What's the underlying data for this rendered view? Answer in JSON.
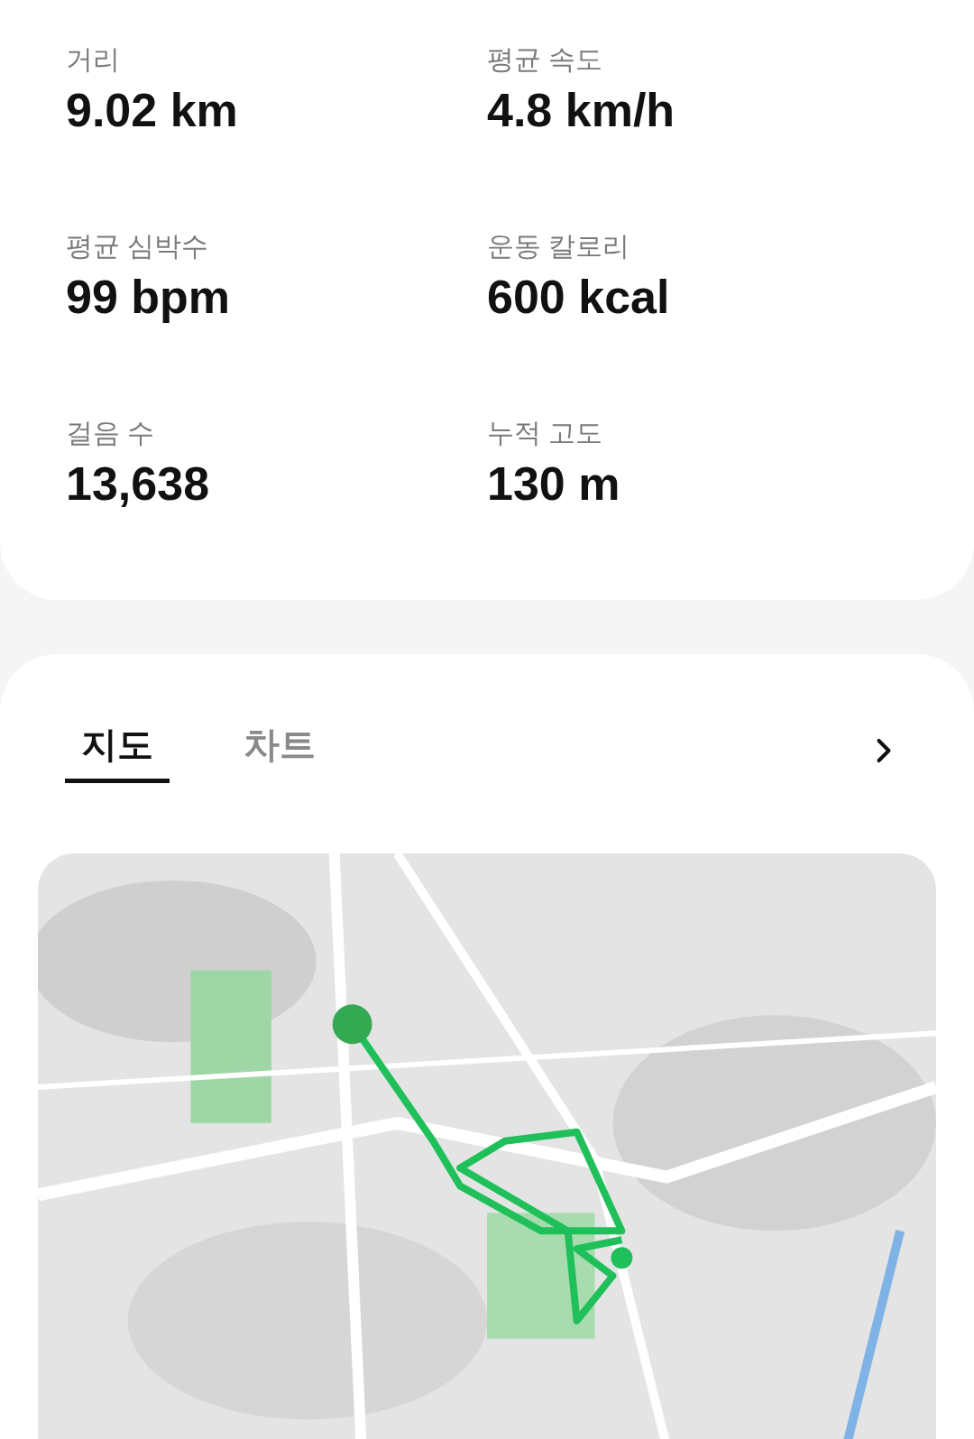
{
  "stats": [
    {
      "label": "거리",
      "value": "9.02 km"
    },
    {
      "label": "평균 속도",
      "value": "4.8 km/h"
    },
    {
      "label": "평균 심박수",
      "value": "99 bpm"
    },
    {
      "label": "운동 칼로리",
      "value": "600 kcal"
    },
    {
      "label": "걸음 수",
      "value": "13,638"
    },
    {
      "label": "누적 고도",
      "value": "130 m"
    }
  ],
  "tabs": [
    {
      "label": "지도",
      "selected": true
    },
    {
      "label": "차트",
      "selected": false
    }
  ]
}
